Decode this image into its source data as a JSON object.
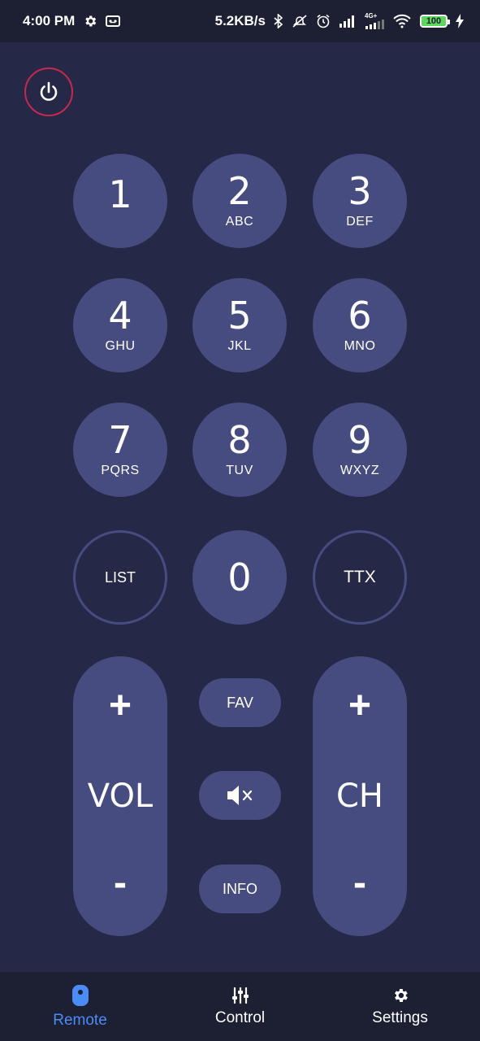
{
  "status_bar": {
    "time": "4:00 PM",
    "speed": "5.2KB/s",
    "network_label": "4G+",
    "battery": "100",
    "icons": [
      "settings-gear-icon",
      "voicemail-icon",
      "bluetooth-icon",
      "muted-notification-icon",
      "alarm-icon",
      "signal-icon",
      "wifi-icon",
      "battery-icon",
      "charging-icon"
    ]
  },
  "power": {
    "icon": "power-icon"
  },
  "keypad": [
    {
      "num": "1",
      "letters": ""
    },
    {
      "num": "2",
      "letters": "ABC"
    },
    {
      "num": "3",
      "letters": "DEF"
    },
    {
      "num": "4",
      "letters": "GHU"
    },
    {
      "num": "5",
      "letters": "JKL"
    },
    {
      "num": "6",
      "letters": "MNO"
    },
    {
      "num": "7",
      "letters": "PQRS"
    },
    {
      "num": "8",
      "letters": "TUV"
    },
    {
      "num": "9",
      "letters": "WXYZ"
    }
  ],
  "row4": {
    "list": "LIST",
    "zero": "0",
    "ttx": "TTX"
  },
  "volume": {
    "plus": "+",
    "label": "VOL",
    "minus": "-"
  },
  "channel": {
    "plus": "+",
    "label": "CH",
    "minus": "-"
  },
  "middle": {
    "fav": "FAV",
    "mute_icon": "mute-icon",
    "info": "INFO"
  },
  "bottom_nav": [
    {
      "label": "Remote",
      "icon": "remote-icon",
      "active": true
    },
    {
      "label": "Control",
      "icon": "sliders-icon",
      "active": false
    },
    {
      "label": "Settings",
      "icon": "gear-icon",
      "active": false
    }
  ],
  "colors": {
    "background": "#252846",
    "button": "#474c80",
    "bar": "#1d2033",
    "active": "#4a8bf5",
    "power_ring": "#c8284f",
    "battery": "#5cd65c"
  }
}
